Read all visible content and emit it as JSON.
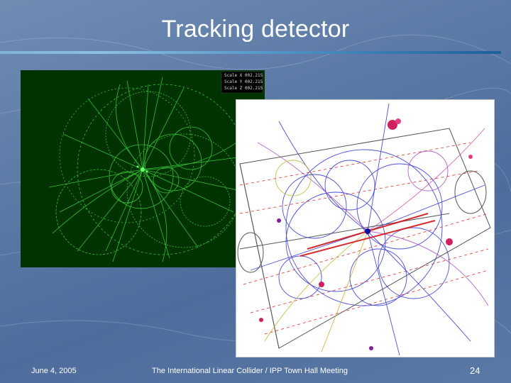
{
  "slide": {
    "title": "Tracking detector",
    "footer": {
      "date": "June 4, 2005",
      "meeting": "The International Linear Collider / IPP Town Hall Meeting",
      "page_number": "24"
    }
  },
  "left_image": {
    "description_icon": "green-event-display",
    "scale_readout": [
      "Scale X 002.215",
      "Scale Y 002.215",
      "Scale Z 002.215"
    ]
  },
  "right_image": {
    "description_icon": "color-event-display"
  },
  "colors": {
    "background": "#5a78a5",
    "title_text": "#ffffff",
    "rule_light": "#8cc0e0",
    "rule_dark": "#1e5f99",
    "left_panel_bg": "#003300",
    "track_green": "#3fd43f"
  }
}
